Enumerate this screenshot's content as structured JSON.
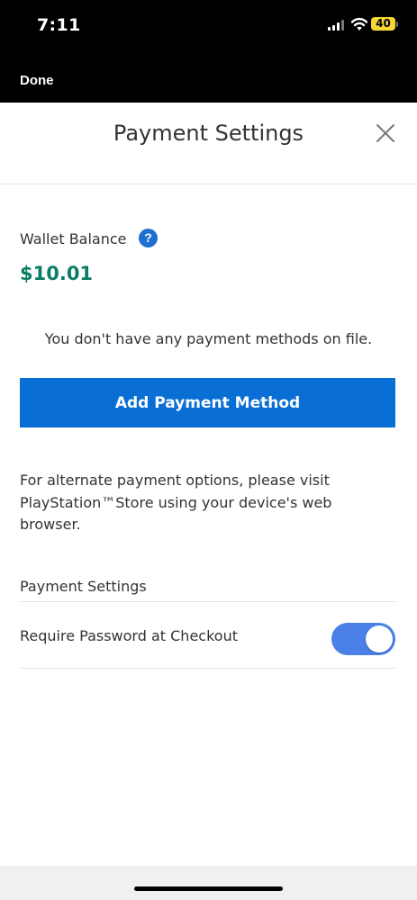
{
  "status_bar": {
    "time": "7:11",
    "battery_level": "40",
    "battery_color": "#f7d733",
    "icons": [
      "cellular-signal-icon",
      "wifi-icon",
      "battery-icon"
    ]
  },
  "nav": {
    "done_label": "Done"
  },
  "header": {
    "title": "Payment Settings",
    "close_icon": "close-icon"
  },
  "wallet": {
    "label": "Wallet Balance",
    "help_glyph": "?",
    "amount": "$10.01",
    "amount_color": "#0a7b64"
  },
  "payment_methods": {
    "empty_message": "You don't have any payment methods on file.",
    "add_button_label": "Add Payment Method",
    "button_color": "#0a6fd5"
  },
  "alternate_note": "For alternate payment options, please visit PlayStation™Store using your device's web browser.",
  "settings": {
    "heading": "Payment Settings",
    "require_password_label": "Require Password at Checkout",
    "require_password_enabled": true,
    "toggle_color": "#4a80e8"
  }
}
